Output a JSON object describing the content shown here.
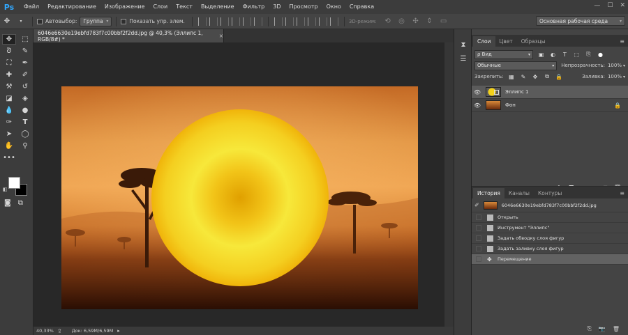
{
  "app": {
    "logo": "Ps"
  },
  "menu": [
    "Файл",
    "Редактирование",
    "Изображение",
    "Слои",
    "Текст",
    "Выделение",
    "Фильтр",
    "3D",
    "Просмотр",
    "Окно",
    "Справка"
  ],
  "window_controls": {
    "minimize": "—",
    "maximize": "☐",
    "close": "✕"
  },
  "options": {
    "autoselect_label": "Автовыбор:",
    "group_value": "Группа",
    "show_controls_label": "Показать упр. элем.",
    "mode3d_label": "3D-режим:",
    "workspace": "Основная рабочая среда"
  },
  "document": {
    "tab_title": "6046e6630e19ebfd783f7c00bbf2f2dd.jpg @ 40,3% (Эллипс 1, RGB/8#) *",
    "tab_close": "×",
    "zoom": "40,33%",
    "doc_info": "Док: 6,59M/6,59M"
  },
  "colors": {
    "sun_center": "#e0a000",
    "sun_ring": "#f7e83a",
    "sun_edge": "#f0b40a",
    "selection_bg": "#5b5b5b",
    "accent": "#31a8ff"
  },
  "layers_panel": {
    "tabs": [
      "Слои",
      "Цвет",
      "Образцы"
    ],
    "menu": "≡",
    "filter_label": "ρ Вид",
    "blend_mode": "Обычные",
    "opacity_label": "Непрозрачность:",
    "opacity_value": "100%",
    "lock_label": "Закрепить:",
    "fill_label": "Заливка:",
    "fill_value": "100%",
    "layers": [
      {
        "name": "Эллипс 1",
        "selected": true,
        "locked": false
      },
      {
        "name": "Фон",
        "selected": false,
        "locked": true
      }
    ]
  },
  "history_panel": {
    "tabs": [
      "История",
      "Каналы",
      "Контуры"
    ],
    "menu": "≡",
    "snapshot": "6046e6630e19ebfd783f7c00bbf2f2dd.jpg",
    "items": [
      {
        "label": "Открыть",
        "selected": false
      },
      {
        "label": "Инструмент \"Эллипс\"",
        "selected": false
      },
      {
        "label": "Задать обводку слоя фигур",
        "selected": false
      },
      {
        "label": "Задать заливку слоя фигур",
        "selected": false
      },
      {
        "label": "Перемещение",
        "selected": true
      }
    ]
  }
}
